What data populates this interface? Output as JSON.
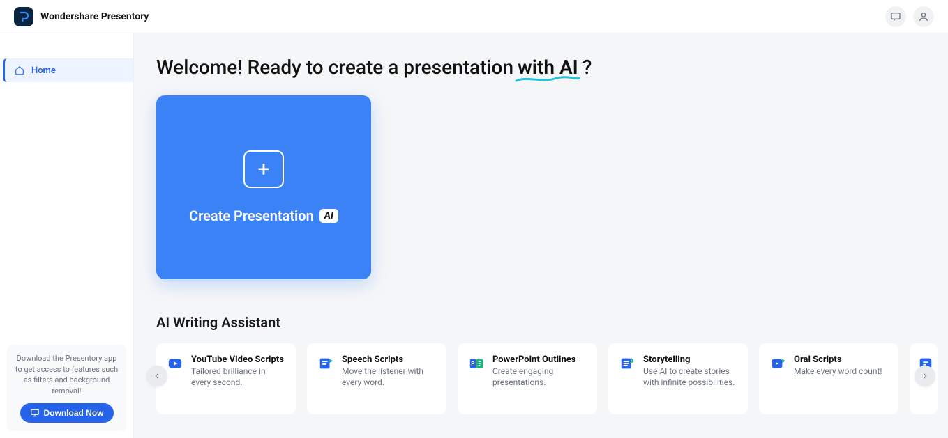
{
  "header": {
    "app_name": "Wondershare Presentory",
    "icons": {
      "feedback": "feedback-icon",
      "user": "user-icon"
    }
  },
  "sidebar": {
    "items": [
      {
        "label": "Home",
        "icon": "home-icon"
      }
    ],
    "promo": {
      "text": "Download the Presentory app to get access to features such as filters and background removal!",
      "button": "Download Now"
    }
  },
  "main": {
    "hero_prefix": "Welcome! Ready to create a presentation",
    "hero_ai": "with AI",
    "hero_suffix": "?",
    "create_card": {
      "label": "Create Presentation",
      "badge": "AI"
    },
    "section_title": "AI Writing Assistant",
    "cards": [
      {
        "title": "YouTube Video Scripts",
        "desc": "Tailored brilliance in every second.",
        "icon": "youtube",
        "color": "#2563eb"
      },
      {
        "title": "Speech Scripts",
        "desc": "Move the listener with every word.",
        "icon": "speech",
        "color": "#2563eb"
      },
      {
        "title": "PowerPoint Outlines",
        "desc": "Create engaging presentations.",
        "icon": "ppt",
        "color": "#10b981"
      },
      {
        "title": "Storytelling",
        "desc": "Use AI to create stories with infinite possibilities.",
        "icon": "story",
        "color": "#2563eb"
      },
      {
        "title": "Oral Scripts",
        "desc": "Make every word count!",
        "icon": "oral",
        "color": "#2563eb"
      }
    ]
  }
}
